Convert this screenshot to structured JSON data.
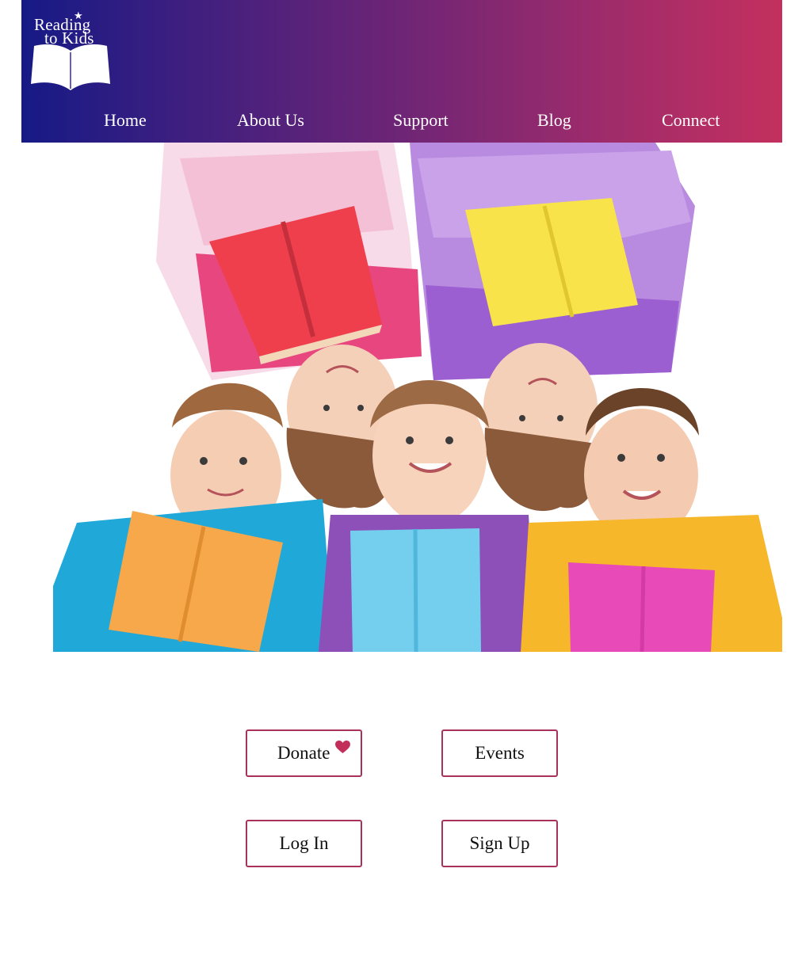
{
  "header": {
    "logo": {
      "line1": "Reading",
      "line2": "to Kids",
      "star_icon": "star-icon",
      "book_icon": "open-book-icon"
    },
    "gradient": [
      "#161a86",
      "#c3305e"
    ],
    "nav": [
      {
        "label": "Home"
      },
      {
        "label": "About Us"
      },
      {
        "label": "Support"
      },
      {
        "label": "Blog"
      },
      {
        "label": "Connect"
      }
    ]
  },
  "hero": {
    "image": "children-reading-books-photo"
  },
  "actions": {
    "donate": {
      "label": "Donate",
      "icon": "heart-icon"
    },
    "events": {
      "label": "Events"
    },
    "login": {
      "label": "Log In"
    },
    "signup": {
      "label": "Sign Up"
    }
  },
  "colors": {
    "accent": "#a8325c",
    "heart": "#c22f5b"
  }
}
